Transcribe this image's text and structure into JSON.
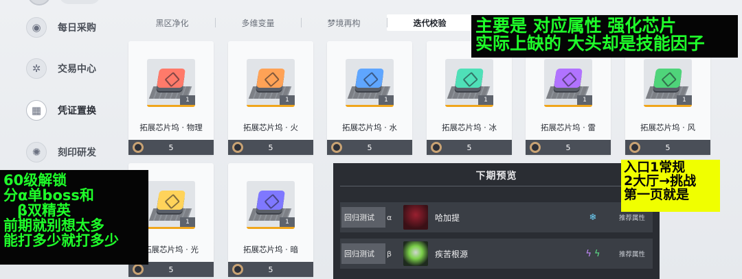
{
  "sidebar": {
    "items": [
      {
        "label": "每日采购",
        "icon": "basket-icon",
        "glyph": "◉"
      },
      {
        "label": "交易中心",
        "icon": "trade-icon",
        "glyph": "✲"
      },
      {
        "label": "凭证置换",
        "icon": "voucher-icon",
        "glyph": "▦",
        "active": true
      },
      {
        "label": "刻印研发",
        "icon": "engrave-icon",
        "glyph": "✺"
      }
    ]
  },
  "tabs": [
    {
      "label": "黑区净化"
    },
    {
      "label": "多维变量"
    },
    {
      "label": "梦境再构"
    },
    {
      "label": "迭代校验",
      "active": true
    }
  ],
  "items": [
    {
      "name": "拓展芯片坞 · 物理",
      "qty": "1",
      "price": "5",
      "color": "#ff7a6a"
    },
    {
      "name": "拓展芯片坞 · 火",
      "qty": "1",
      "price": "5",
      "color": "#ffa256"
    },
    {
      "name": "拓展芯片坞 · 水",
      "qty": "1",
      "price": "5",
      "color": "#5fa6ff"
    },
    {
      "name": "拓展芯片坞 · 冰",
      "qty": "1",
      "price": "5",
      "color": "#4fe0b8"
    },
    {
      "name": "拓展芯片坞 · 雷",
      "qty": "1",
      "price": "5",
      "color": "#b173ff"
    },
    {
      "name": "拓展芯片坞 · 风",
      "qty": "1",
      "price": "5",
      "color": "#4fd47a"
    },
    {
      "name": "拓展芯片坞 · 光",
      "qty": "1",
      "price": "5",
      "color": "#ffd35a"
    },
    {
      "name": "拓展芯片坞 · 暗",
      "qty": "1",
      "price": "5",
      "color": "#7f78ff"
    }
  ],
  "preview": {
    "title": "下期预览",
    "rows": [
      {
        "label": "回归测试",
        "greek": "α",
        "boss": "哈加提",
        "elements": [
          "❄"
        ],
        "elem_colors": [
          "#6fd6ff"
        ],
        "rec": "推荐属性"
      },
      {
        "label": "回归测试",
        "greek": "β",
        "boss": "疾苦根源",
        "elements": [
          "ϟ",
          "ϟ"
        ],
        "elem_colors": [
          "#c58bff",
          "#5fe08a"
        ],
        "rec": "推荐属性"
      }
    ]
  },
  "notes": {
    "a": [
      "主要是 对应属性 强化芯片",
      "实际上缺的 大头却是技能因子"
    ],
    "b": [
      "60级解锁",
      "分α单boss和",
      "β双精英",
      "前期就别想太多",
      "能打多少就打多少"
    ],
    "c": [
      "入口1常规",
      "2大厅→挑战",
      "第一页就是"
    ]
  }
}
